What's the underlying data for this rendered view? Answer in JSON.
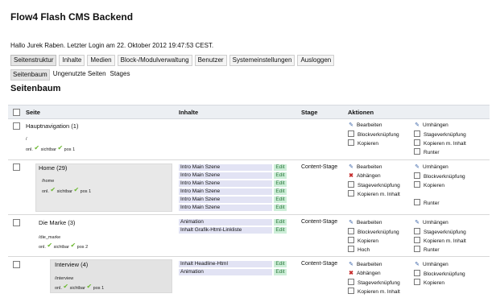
{
  "title": "Flow4 Flash CMS Backend",
  "greeting": "Hallo Jurek Raben. Letzter Login am 22. Oktober 2012 19:47:53 CEST.",
  "nav": [
    "Seitenstruktur",
    "Inhalte",
    "Medien",
    "Block-/Modulverwaltung",
    "Benutzer",
    "Systemeinstellungen",
    "Ausloggen"
  ],
  "subnav": [
    "Seitenbaum",
    "Ungenutzte Seiten",
    "Stages"
  ],
  "section_title": "Seitenbaum",
  "columns": {
    "seite": "Seite",
    "inhalte": "Inhalte",
    "stage": "Stage",
    "aktionen": "Aktionen"
  },
  "rows": [
    {
      "name": "Hauptnavigation (1)",
      "path": "/",
      "onl": "onl.",
      "sichtbar": "sichtbar",
      "pos": "pos 1",
      "stage": "",
      "contents": [],
      "actions_left": [
        "Bearbeiten",
        "Blockverknüpfung",
        "Kopieren"
      ],
      "actions_right": [
        "Umhängen",
        "Stageverknüpfung",
        "Kopieren m. Inhalt",
        "Runter"
      ]
    },
    {
      "name": "Home (29)",
      "path": "/home",
      "onl": "onl.",
      "sichtbar": "sichtbar",
      "pos": "pos 1",
      "stage": "Content-Stage",
      "contents": [
        "Intro Main Szene",
        "Intro Main Szene",
        "Intro Main Szene",
        "Intro Main Szene",
        "Intro Main Szene",
        "Intro Main Szene"
      ],
      "actions_left": [
        "Bearbeiten",
        "Abhängen",
        "Stageverknüpfung",
        "Kopieren m. Inhalt"
      ],
      "actions_right": [
        "Umhängen",
        "Blockverknüpfung",
        "Kopieren",
        "Runter"
      ]
    },
    {
      "name": "Die Marke (3)",
      "path": "/die_marke",
      "onl": "onl.",
      "sichtbar": "sichtbar",
      "pos": "pos 2",
      "stage": "Content-Stage",
      "contents": [
        "Animation",
        "Inhalt Grafik-Html-Linkliste"
      ],
      "actions_left": [
        "Bearbeiten",
        "Blockverknüpfung",
        "Kopieren",
        "Hoch"
      ],
      "actions_right": [
        "Umhängen",
        "Stageverknüpfung",
        "Kopieren m. Inhalt",
        "Runter"
      ]
    },
    {
      "name": "Interview (4)",
      "path": "/interview",
      "onl": "onl.",
      "sichtbar": "sichtbar",
      "pos": "pos 1",
      "stage": "Content-Stage",
      "contents": [
        "Inhalt Headline-Html",
        "Animation"
      ],
      "actions_left": [
        "Bearbeiten",
        "Abhängen",
        "Stageverknüpfung",
        "Kopieren m. Inhalt"
      ],
      "actions_right": [
        "Umhängen",
        "Blockverknüpfung",
        "Kopieren"
      ]
    }
  ],
  "edit_label": "Edit",
  "colors": {
    "content_bg": "#e2e3f4",
    "edit_bg": "#cdeed8",
    "tick": "#6bb82f",
    "pencil": "#3b64a8",
    "remove": "#c62b2b"
  }
}
